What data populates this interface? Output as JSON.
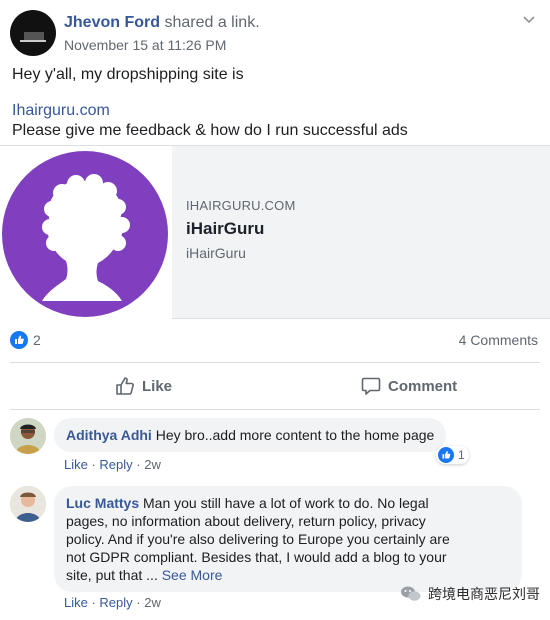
{
  "post": {
    "author": "Jhevon Ford",
    "action": "shared a link.",
    "timestamp": "November 15 at 11:26 PM",
    "text_line1": "Hey y'all, my dropshipping site is",
    "link_text": "Ihairguru.com",
    "text_line3": "Please give me feedback & how do I run successful ads"
  },
  "link_card": {
    "domain": "IHAIRGURU.COM",
    "title": "iHairGuru",
    "description": "iHairGuru",
    "logo_color": "#7f3fbf"
  },
  "reactions": {
    "count": "2",
    "comments": "4 Comments"
  },
  "actions": {
    "like_label": "Like",
    "comment_label": "Comment"
  },
  "comments": [
    {
      "name": "Adithya Adhi",
      "text": "Hey bro..add more content to the home page",
      "like": "Like",
      "reply": "Reply",
      "time": "2w",
      "reaction_count": "1"
    },
    {
      "name": "Luc Mattys",
      "line1": "Man you still have a lot of work to do. No legal",
      "line2": "pages, no information about delivery, return policy, privacy",
      "line3": "policy. And if you're also delivering to Europe you certainly are",
      "line4": "not GDPR compliant. Besides that, I would add a blog to your",
      "line5": "site, put that ...",
      "see_more": "See More",
      "like": "Like",
      "reply": "Reply",
      "time": "2w"
    }
  ],
  "watermark": {
    "text": "跨境电商恶尼刘哥"
  },
  "colors": {
    "link": "#365899",
    "like_blue": "#1877f2",
    "bubble": "#f2f3f5"
  }
}
